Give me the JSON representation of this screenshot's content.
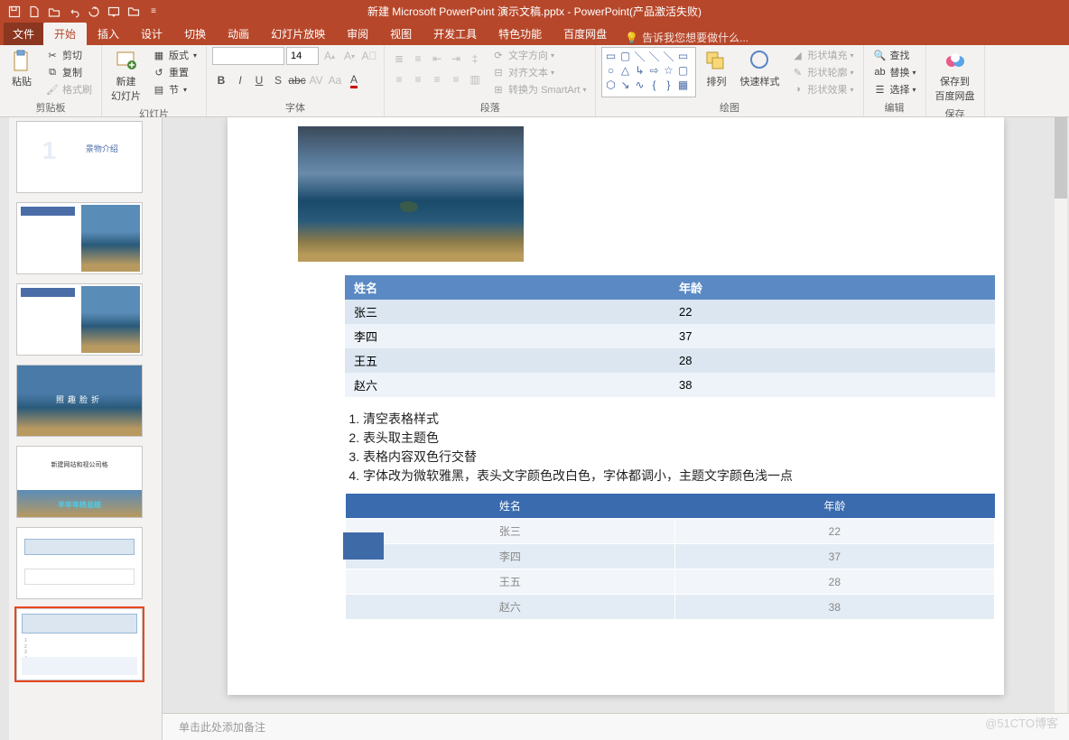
{
  "title": "新建 Microsoft PowerPoint 演示文稿.pptx - PowerPoint(产品激活失败)",
  "tabs": {
    "file": "文件",
    "home": "开始",
    "insert": "插入",
    "design": "设计",
    "transitions": "切换",
    "animations": "动画",
    "slideshow": "幻灯片放映",
    "review": "审阅",
    "view": "视图",
    "dev": "开发工具",
    "special": "特色功能",
    "baidu": "百度网盘",
    "tellme": "告诉我您想要做什么..."
  },
  "ribbon": {
    "clipboard": {
      "label": "剪贴板",
      "paste": "粘贴",
      "cut": "剪切",
      "copy": "复制",
      "painter": "格式刷"
    },
    "slides": {
      "label": "幻灯片",
      "new": "新建\n幻灯片",
      "layout": "版式",
      "reset": "重置",
      "section": "节"
    },
    "font": {
      "label": "字体",
      "name": "",
      "size": "14"
    },
    "para": {
      "label": "段落",
      "textdir": "文字方向",
      "align": "对齐文本",
      "smartart": "转换为 SmartArt"
    },
    "drawing": {
      "label": "绘图",
      "arrange": "排列",
      "quick": "快速样式",
      "fill": "形状填充",
      "outline": "形状轮廓",
      "effects": "形状效果"
    },
    "editing": {
      "label": "编辑",
      "find": "查找",
      "replace": "替换",
      "select": "选择"
    },
    "save": {
      "label": "保存",
      "cloud": "保存到\n百度网盘"
    }
  },
  "slide": {
    "table1": {
      "headers": [
        "姓名",
        "年龄"
      ],
      "rows": [
        [
          "张三",
          "22"
        ],
        [
          "李四",
          "37"
        ],
        [
          "王五",
          "28"
        ],
        [
          "赵六",
          "38"
        ]
      ]
    },
    "list": [
      "清空表格样式",
      "表头取主题色",
      "表格内容双色行交替",
      "字体改为微软雅黑，表头文字颜色改白色，字体都调小，主题文字颜色浅一点"
    ],
    "table2": {
      "headers": [
        "姓名",
        "年龄"
      ],
      "rows": [
        [
          "张三",
          "22"
        ],
        [
          "李四",
          "37"
        ],
        [
          "王五",
          "28"
        ],
        [
          "赵六",
          "38"
        ]
      ]
    }
  },
  "notes_placeholder": "单击此处添加备注",
  "watermark": "@51CTO博客"
}
